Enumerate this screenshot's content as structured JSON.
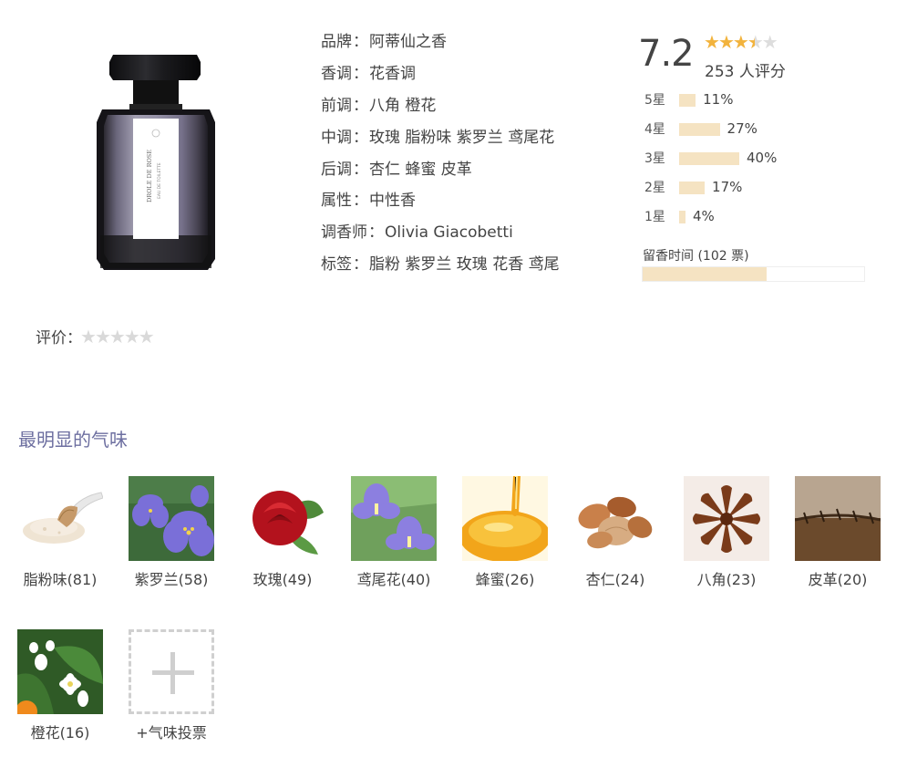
{
  "product": {
    "bottle_label": "DROLE DE ROSE",
    "bottle_sublabel": "EAU DE TOILETTE"
  },
  "info": [
    {
      "key": "品牌",
      "value": "阿蒂仙之香"
    },
    {
      "key": "香调",
      "value": "花香调"
    },
    {
      "key": "前调",
      "value": "八角 橙花"
    },
    {
      "key": "中调",
      "value": "玫瑰 脂粉味 紫罗兰 鸢尾花"
    },
    {
      "key": "后调",
      "value": "杏仁 蜂蜜 皮革"
    },
    {
      "key": "属性",
      "value": "中性香"
    },
    {
      "key": "调香师",
      "value": "Olivia Giacobetti"
    },
    {
      "key": "标签",
      "value": "脂粉 紫罗兰 玫瑰 花香 鸢尾"
    }
  ],
  "rating": {
    "score": "7.2",
    "stars": 3.5,
    "count_text": "253 人评分",
    "distribution": [
      {
        "label": "5星",
        "percent": 11,
        "text": "11%"
      },
      {
        "label": "4星",
        "percent": 27,
        "text": "27%"
      },
      {
        "label": "3星",
        "percent": 40,
        "text": "40%"
      },
      {
        "label": "2星",
        "percent": 17,
        "text": "17%"
      },
      {
        "label": "1星",
        "percent": 4,
        "text": "4%"
      }
    ],
    "longevity_label": "留香时间 (102 票)",
    "longevity_fraction": 0.56
  },
  "my_rating": {
    "label": "评价：",
    "stars": 0
  },
  "section_title": "最明显的气味",
  "smells": [
    {
      "name": "脂粉味(81)",
      "icon": "powder-brush-icon"
    },
    {
      "name": "紫罗兰(58)",
      "icon": "violet-flower-icon"
    },
    {
      "name": "玫瑰(49)",
      "icon": "rose-icon"
    },
    {
      "name": "鸢尾花(40)",
      "icon": "iris-flower-icon"
    },
    {
      "name": "蜂蜜(26)",
      "icon": "honey-icon"
    },
    {
      "name": "杏仁(24)",
      "icon": "almond-icon"
    },
    {
      "name": "八角(23)",
      "icon": "star-anise-icon"
    },
    {
      "name": "皮革(20)",
      "icon": "leather-icon"
    },
    {
      "name": "橙花(16)",
      "icon": "orange-blossom-icon"
    }
  ],
  "vote": {
    "label": "+气味投票"
  },
  "colors": {
    "accent_title": "#6d6fa0",
    "star_on": "#f2b33d",
    "star_off": "#dddddd",
    "bar": "#f5e3c2"
  }
}
